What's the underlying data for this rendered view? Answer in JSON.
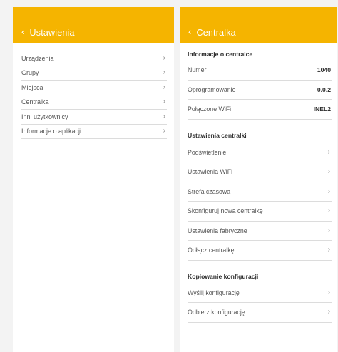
{
  "left_panel": {
    "back_glyph": "‹",
    "title": "Ustawienia",
    "chevron": "›",
    "items": [
      {
        "label": "Urządzenia"
      },
      {
        "label": "Grupy"
      },
      {
        "label": "Miejsca"
      },
      {
        "label": "Centralka"
      },
      {
        "label": "Inni użytkownicy"
      },
      {
        "label": "Informacje o aplikacji"
      }
    ]
  },
  "right_panel": {
    "back_glyph": "‹",
    "title": "Centralka",
    "chevron": "›",
    "info_section": {
      "title": "Informacje o centralce",
      "rows": [
        {
          "label": "Numer",
          "value": "1040"
        },
        {
          "label": "Oprogramowanie",
          "value": "0.0.2"
        },
        {
          "label": "Połączone WiFi",
          "value": "INEL2"
        }
      ]
    },
    "settings_section": {
      "title": "Ustawienia centralki",
      "items": [
        {
          "label": "Podświetlenie"
        },
        {
          "label": "Ustawienia WiFi"
        },
        {
          "label": "Strefa czasowa"
        },
        {
          "label": "Skonfiguruj nową centralkę"
        },
        {
          "label": "Ustawienia fabryczne"
        },
        {
          "label": "Odłącz centralkę"
        }
      ]
    },
    "copy_section": {
      "title": "Kopiowanie konfiguracji",
      "items": [
        {
          "label": "Wyślij konfigurację"
        },
        {
          "label": "Odbierz konfigurację"
        }
      ]
    }
  },
  "colors": {
    "accent": "#f5b400",
    "background": "#f3f3f3",
    "panel": "#ffffff",
    "divider": "#dcdcdc"
  },
  "icons": {
    "back": "back-arrow-icon",
    "row_chevron": "chevron-right-icon"
  }
}
